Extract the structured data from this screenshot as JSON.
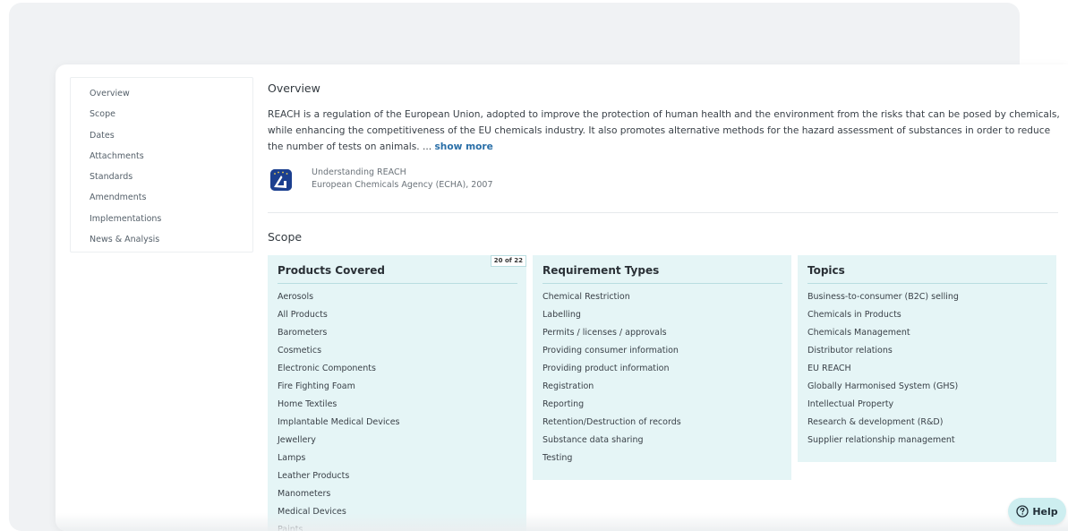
{
  "sidenav": {
    "items": [
      {
        "label": "Overview"
      },
      {
        "label": "Scope"
      },
      {
        "label": "Dates"
      },
      {
        "label": "Attachments"
      },
      {
        "label": "Standards"
      },
      {
        "label": "Amendments"
      },
      {
        "label": "Implementations"
      },
      {
        "label": "News & Analysis"
      }
    ]
  },
  "overview": {
    "title": "Overview",
    "description": "REACH is a regulation of the European Union, adopted to improve the protection of human health and the environment from the risks that can be posed by chemicals, while enhancing the competitiveness of the EU chemicals industry. It also promotes alternative methods for the hazard assessment of substances in order to reduce the number of tests on animals. ...",
    "show_more": "show more",
    "source": {
      "title": "Understanding REACH",
      "publisher": "European Chemicals Agency (ECHA), 2007",
      "logo_icon": "echa-logo-icon"
    }
  },
  "scope": {
    "title": "Scope",
    "products": {
      "heading": "Products Covered",
      "badge": "20 of 22",
      "items": [
        "Aerosols",
        "All Products",
        "Barometers",
        "Cosmetics",
        "Electronic Components",
        "Fire Fighting Foam",
        "Home Textiles",
        "Implantable Medical Devices",
        "Jewellery",
        "Lamps",
        "Leather Products",
        "Manometers",
        "Medical Devices",
        "Paints"
      ]
    },
    "requirements": {
      "heading": "Requirement Types",
      "items": [
        "Chemical Restriction",
        "Labelling",
        "Permits / licenses / approvals",
        "Providing consumer information",
        "Providing product information",
        "Registration",
        "Reporting",
        "Retention/Destruction of records",
        "Substance data sharing",
        "Testing"
      ]
    },
    "topics": {
      "heading": "Topics",
      "items": [
        "Business-to-consumer (B2C) selling",
        "Chemicals in Products",
        "Chemicals Management",
        "Distributor relations",
        "EU REACH",
        "Globally Harmonised System (GHS)",
        "Intellectual Property",
        "Research & development (R&D)",
        "Supplier relationship management"
      ]
    }
  },
  "help": {
    "label": "Help",
    "icon": "question-circle-icon"
  },
  "colors": {
    "accent": "#2a6fa8",
    "panel": "#e5f5f6",
    "help_bg": "#cdeef0"
  }
}
